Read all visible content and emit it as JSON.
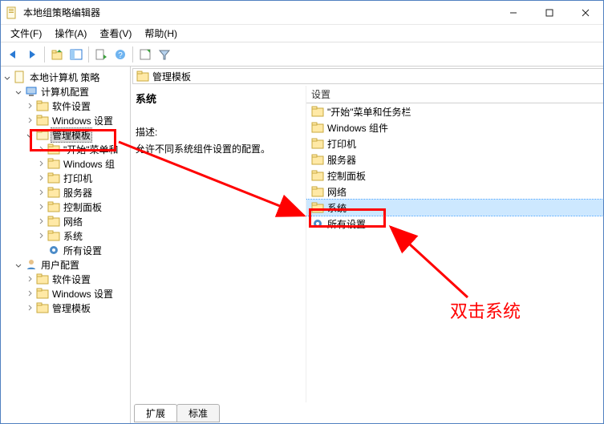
{
  "window": {
    "title": "本地组策略编辑器"
  },
  "menu": {
    "file": "文件(F)",
    "action": "操作(A)",
    "view": "查看(V)",
    "help": "帮助(H)"
  },
  "tree": {
    "root": "本地计算机 策略",
    "computer": "计算机配置",
    "software": "软件设置",
    "windows_settings": "Windows 设置",
    "admin_templates": "管理模板",
    "start_taskbar": "\"开始\"菜单和",
    "windows_comp": "Windows 组",
    "printers": "打印机",
    "servers": "服务器",
    "control_panel": "控制面板",
    "network": "网络",
    "system": "系统",
    "all_settings": "所有设置",
    "user": "用户配置",
    "u_software": "软件设置",
    "u_windows_settings": "Windows 设置",
    "u_admin_templates": "管理模板"
  },
  "breadcrumb": {
    "label": "管理模板"
  },
  "detail": {
    "selected": "系统",
    "desc_label": "描述:",
    "desc_text": "允许不同系统组件设置的配置。"
  },
  "list": {
    "header": "设置",
    "items": [
      {
        "label": "\"开始\"菜单和任务栏",
        "type": "folder"
      },
      {
        "label": "Windows 组件",
        "type": "folder"
      },
      {
        "label": "打印机",
        "type": "folder"
      },
      {
        "label": "服务器",
        "type": "folder"
      },
      {
        "label": "控制面板",
        "type": "folder"
      },
      {
        "label": "网络",
        "type": "folder"
      },
      {
        "label": "系统",
        "type": "folder",
        "selected": true
      },
      {
        "label": "所有设置",
        "type": "settings"
      }
    ]
  },
  "tabs": {
    "extended": "扩展",
    "standard": "标准"
  },
  "annotation": {
    "text": "双击系统"
  }
}
